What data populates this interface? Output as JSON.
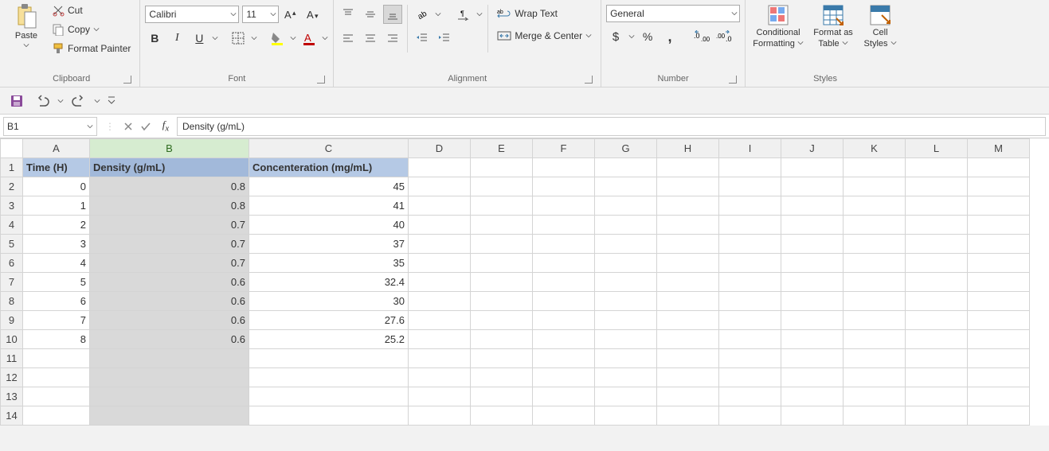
{
  "clipboard": {
    "paste": "Paste",
    "cut": "Cut",
    "copy": "Copy",
    "format_painter": "Format Painter",
    "label": "Clipboard"
  },
  "font": {
    "family": "Calibri",
    "size": "11",
    "label": "Font"
  },
  "alignment": {
    "wrap": "Wrap Text",
    "merge": "Merge & Center",
    "label": "Alignment"
  },
  "number": {
    "format": "General",
    "label": "Number"
  },
  "styles": {
    "conditional_l1": "Conditional",
    "conditional_l2": "Formatting",
    "table_l1": "Format as",
    "table_l2": "Table",
    "cell_l1": "Cell",
    "cell_l2": "Styles",
    "label": "Styles"
  },
  "namebox": "B1",
  "formula": "Density (g/mL)",
  "columns": [
    "A",
    "B",
    "C",
    "D",
    "E",
    "F",
    "G",
    "H",
    "I",
    "J",
    "K",
    "L",
    "M"
  ],
  "col_widths": [
    "col-A",
    "col-B",
    "col-C",
    "col-rest",
    "col-rest",
    "col-rest",
    "col-rest",
    "col-rest",
    "col-rest",
    "col-rest",
    "col-rest",
    "col-rest",
    "col-rest"
  ],
  "rows": [
    "1",
    "2",
    "3",
    "4",
    "5",
    "6",
    "7",
    "8",
    "9",
    "10",
    "11",
    "12",
    "13",
    "14"
  ],
  "headers": {
    "A": "Time (H)",
    "B": "Density (g/mL)",
    "C": "Concenteration (mg/mL)"
  },
  "data": {
    "2": {
      "A": "0",
      "B": "0.8",
      "C": "45"
    },
    "3": {
      "A": "1",
      "B": "0.8",
      "C": "41"
    },
    "4": {
      "A": "2",
      "B": "0.7",
      "C": "40"
    },
    "5": {
      "A": "3",
      "B": "0.7",
      "C": "37"
    },
    "6": {
      "A": "4",
      "B": "0.7",
      "C": "35"
    },
    "7": {
      "A": "5",
      "B": "0.6",
      "C": "32.4"
    },
    "8": {
      "A": "6",
      "B": "0.6",
      "C": "30"
    },
    "9": {
      "A": "7",
      "B": "0.6",
      "C": "27.6"
    },
    "10": {
      "A": "8",
      "B": "0.6",
      "C": "25.2"
    }
  },
  "selected_column": "B"
}
